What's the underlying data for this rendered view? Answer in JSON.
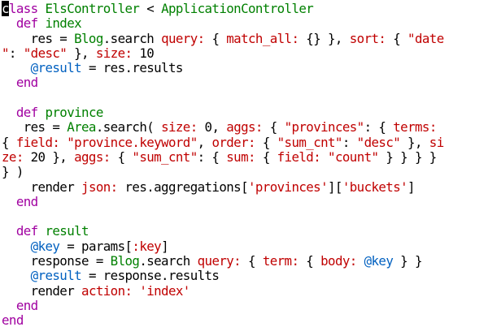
{
  "colors": {
    "background": "#ffffff",
    "plain": "#000000",
    "keyword": "#a000a0",
    "constant": "#008000",
    "symbol": "#c00000",
    "instance_var": "#0060c0",
    "cursor_bg": "#000000",
    "cursor_fg": "#ffffff"
  },
  "lines": [
    [
      {
        "t": "c",
        "k": "cursor"
      },
      {
        "t": "lass ",
        "k": "keyword"
      },
      {
        "t": "ElsController",
        "k": "constant"
      },
      {
        "t": " < ",
        "k": "plain"
      },
      {
        "t": "ApplicationController",
        "k": "constant"
      }
    ],
    [
      {
        "t": "  ",
        "k": "plain"
      },
      {
        "t": "def",
        "k": "keyword"
      },
      {
        "t": " ",
        "k": "plain"
      },
      {
        "t": "index",
        "k": "constant"
      }
    ],
    [
      {
        "t": "    res = ",
        "k": "plain"
      },
      {
        "t": "Blog",
        "k": "constant"
      },
      {
        "t": ".search ",
        "k": "plain"
      },
      {
        "t": "query:",
        "k": "symbol"
      },
      {
        "t": " { ",
        "k": "plain"
      },
      {
        "t": "match_all:",
        "k": "symbol"
      },
      {
        "t": " {} }, ",
        "k": "plain"
      },
      {
        "t": "sort:",
        "k": "symbol"
      },
      {
        "t": " { ",
        "k": "plain"
      },
      {
        "t": "\"date",
        "k": "symbol"
      }
    ],
    [
      {
        "t": "\"",
        "k": "symbol"
      },
      {
        "t": ": ",
        "k": "plain"
      },
      {
        "t": "\"desc\"",
        "k": "symbol"
      },
      {
        "t": " }, ",
        "k": "plain"
      },
      {
        "t": "size:",
        "k": "symbol"
      },
      {
        "t": " 10",
        "k": "plain"
      }
    ],
    [
      {
        "t": "    ",
        "k": "plain"
      },
      {
        "t": "@result",
        "k": "instance_var"
      },
      {
        "t": " = res.results",
        "k": "plain"
      }
    ],
    [
      {
        "t": "  ",
        "k": "plain"
      },
      {
        "t": "end",
        "k": "keyword"
      }
    ],
    [],
    [
      {
        "t": "  ",
        "k": "plain"
      },
      {
        "t": "def",
        "k": "keyword"
      },
      {
        "t": " ",
        "k": "plain"
      },
      {
        "t": "province",
        "k": "constant"
      }
    ],
    [
      {
        "t": "   res = ",
        "k": "plain"
      },
      {
        "t": "Area",
        "k": "constant"
      },
      {
        "t": ".search( ",
        "k": "plain"
      },
      {
        "t": "size:",
        "k": "symbol"
      },
      {
        "t": " 0, ",
        "k": "plain"
      },
      {
        "t": "aggs:",
        "k": "symbol"
      },
      {
        "t": " { ",
        "k": "plain"
      },
      {
        "t": "\"provinces\"",
        "k": "symbol"
      },
      {
        "t": ": { ",
        "k": "plain"
      },
      {
        "t": "terms:",
        "k": "symbol"
      }
    ],
    [
      {
        "t": "{ ",
        "k": "plain"
      },
      {
        "t": "field:",
        "k": "symbol"
      },
      {
        "t": " ",
        "k": "plain"
      },
      {
        "t": "\"province.keyword\"",
        "k": "symbol"
      },
      {
        "t": ", ",
        "k": "plain"
      },
      {
        "t": "order:",
        "k": "symbol"
      },
      {
        "t": " { ",
        "k": "plain"
      },
      {
        "t": "\"sum_cnt\"",
        "k": "symbol"
      },
      {
        "t": ": ",
        "k": "plain"
      },
      {
        "t": "\"desc\"",
        "k": "symbol"
      },
      {
        "t": " }, ",
        "k": "plain"
      },
      {
        "t": "si",
        "k": "symbol"
      }
    ],
    [
      {
        "t": "ze:",
        "k": "symbol"
      },
      {
        "t": " 20 }, ",
        "k": "plain"
      },
      {
        "t": "aggs:",
        "k": "symbol"
      },
      {
        "t": " { ",
        "k": "plain"
      },
      {
        "t": "\"sum_cnt\"",
        "k": "symbol"
      },
      {
        "t": ": { ",
        "k": "plain"
      },
      {
        "t": "sum:",
        "k": "symbol"
      },
      {
        "t": " { ",
        "k": "plain"
      },
      {
        "t": "field:",
        "k": "symbol"
      },
      {
        "t": " ",
        "k": "plain"
      },
      {
        "t": "\"count\"",
        "k": "symbol"
      },
      {
        "t": " } } } }",
        "k": "plain"
      }
    ],
    [
      {
        "t": "} )",
        "k": "plain"
      }
    ],
    [
      {
        "t": "    render ",
        "k": "plain"
      },
      {
        "t": "json:",
        "k": "symbol"
      },
      {
        "t": " res.aggregations[",
        "k": "plain"
      },
      {
        "t": "'provinces'",
        "k": "symbol"
      },
      {
        "t": "][",
        "k": "plain"
      },
      {
        "t": "'buckets'",
        "k": "symbol"
      },
      {
        "t": "]",
        "k": "plain"
      }
    ],
    [
      {
        "t": "  ",
        "k": "plain"
      },
      {
        "t": "end",
        "k": "keyword"
      }
    ],
    [],
    [
      {
        "t": "  ",
        "k": "plain"
      },
      {
        "t": "def",
        "k": "keyword"
      },
      {
        "t": " ",
        "k": "plain"
      },
      {
        "t": "result",
        "k": "constant"
      }
    ],
    [
      {
        "t": "    ",
        "k": "plain"
      },
      {
        "t": "@key",
        "k": "instance_var"
      },
      {
        "t": " = params[",
        "k": "plain"
      },
      {
        "t": ":key",
        "k": "symbol"
      },
      {
        "t": "]",
        "k": "plain"
      }
    ],
    [
      {
        "t": "    response = ",
        "k": "plain"
      },
      {
        "t": "Blog",
        "k": "constant"
      },
      {
        "t": ".search ",
        "k": "plain"
      },
      {
        "t": "query:",
        "k": "symbol"
      },
      {
        "t": " { ",
        "k": "plain"
      },
      {
        "t": "term:",
        "k": "symbol"
      },
      {
        "t": " { ",
        "k": "plain"
      },
      {
        "t": "body:",
        "k": "symbol"
      },
      {
        "t": " ",
        "k": "plain"
      },
      {
        "t": "@key",
        "k": "instance_var"
      },
      {
        "t": " } }",
        "k": "plain"
      }
    ],
    [
      {
        "t": "    ",
        "k": "plain"
      },
      {
        "t": "@result",
        "k": "instance_var"
      },
      {
        "t": " = response.results",
        "k": "plain"
      }
    ],
    [
      {
        "t": "    render ",
        "k": "plain"
      },
      {
        "t": "action:",
        "k": "symbol"
      },
      {
        "t": " ",
        "k": "plain"
      },
      {
        "t": "'index'",
        "k": "symbol"
      }
    ],
    [
      {
        "t": "  ",
        "k": "plain"
      },
      {
        "t": "end",
        "k": "keyword"
      }
    ],
    [
      {
        "t": "end",
        "k": "keyword"
      }
    ]
  ]
}
